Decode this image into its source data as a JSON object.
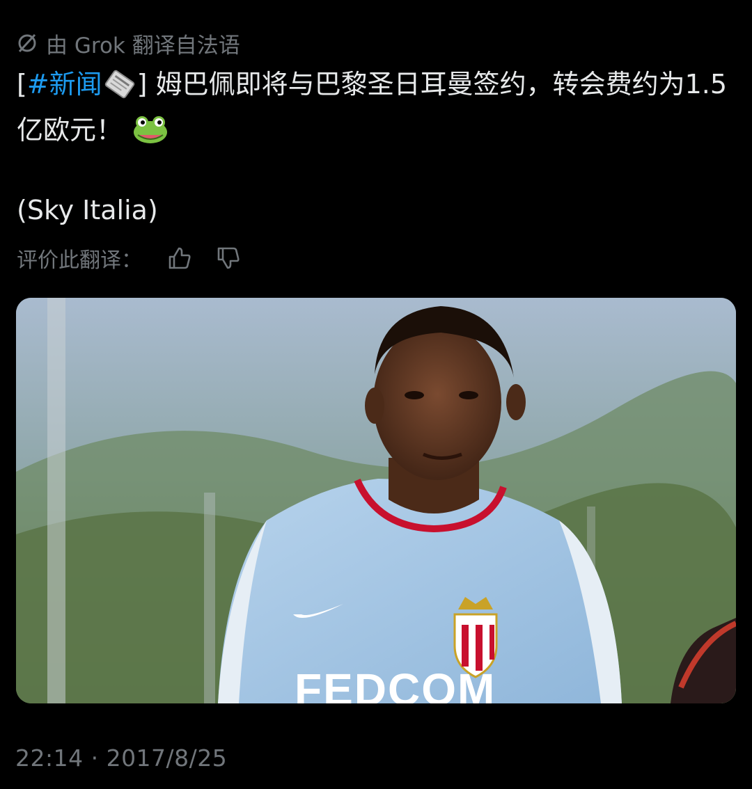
{
  "translation": {
    "label": "由 Grok 翻译自法语"
  },
  "tweet": {
    "hashtag_open": "[",
    "hashtag": "#新闻",
    "text_after_tag": "] 姆巴佩即将与巴黎圣日耳曼签约，转会费约为1.5亿欧元！",
    "source": "(Sky Italia)"
  },
  "rating": {
    "label": "评价此翻译：",
    "icons": [
      "thumbs-up-icon",
      "thumbs-down-icon"
    ]
  },
  "media": {
    "jersey_text": "FEDCOM"
  },
  "meta": {
    "timestamp": "22:14 · 2017/8/25"
  },
  "colors": {
    "background": "#000000",
    "text": "#e7e9ea",
    "muted": "#71767b",
    "link": "#1d9bf0"
  }
}
